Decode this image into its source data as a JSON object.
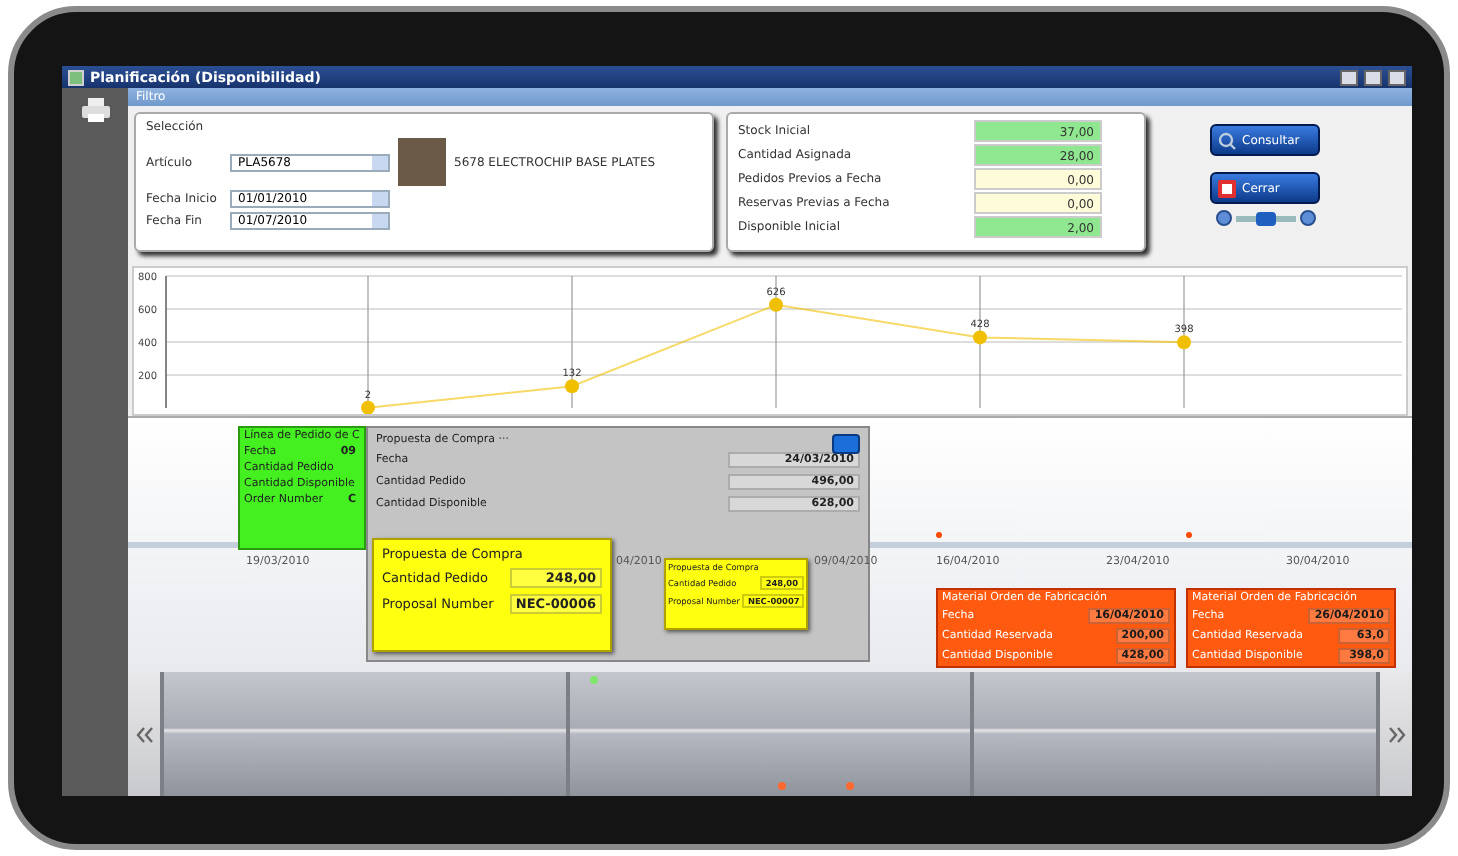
{
  "window": {
    "title": "Planificación (Disponibilidad)"
  },
  "filter_bar": {
    "title": "Filtro"
  },
  "selection": {
    "legend": "Selección",
    "article_label": "Artículo",
    "article": "PLA5678",
    "description": "5678 ELECTROCHIP BASE PLATES",
    "start_label": "Fecha Inicio",
    "start_date": "01/01/2010",
    "end_label": "Fecha Fin",
    "end_date": "01/07/2010"
  },
  "stock": [
    {
      "label": "Stock Inicial",
      "value": "37,00",
      "color": "#8fe88f"
    },
    {
      "label": "Cantidad Asignada",
      "value": "28,00",
      "color": "#8fe88f"
    },
    {
      "label": "Pedidos Previos a Fecha",
      "value": "0,00",
      "color": "#fdfbd8"
    },
    {
      "label": "Reservas Previas a Fecha",
      "value": "0,00",
      "color": "#fdfbd8"
    },
    {
      "label": "Disponible Inicial",
      "value": "2,00",
      "color": "#8fe88f"
    }
  ],
  "buttons": [
    {
      "label": "Consultar",
      "kind": "search"
    },
    {
      "label": "Cerrar",
      "kind": "close"
    }
  ],
  "zoom_slider": {
    "level": 0.5
  },
  "chart": {
    "chart_data": {
      "type": "line",
      "grid": true,
      "series": [
        {
          "color": "#f0c000",
          "marker": true,
          "values": [
            2,
            132,
            626,
            428,
            398
          ]
        }
      ],
      "ylim": [
        0,
        800
      ],
      "yticks": [
        200,
        400,
        600,
        800
      ],
      "data_labels": true
    }
  },
  "timeline": {
    "dates": [
      "19/03/2010",
      "04/2010",
      "09/04/2010",
      "16/04/2010",
      "23/04/2010",
      "30/04/2010"
    ],
    "cards": [
      {
        "kind": "order_line",
        "title": "Línea de Pedido de C",
        "fields": [
          {
            "label": "Fecha",
            "value": "09"
          },
          {
            "label": "Cantidad Pedido"
          },
          {
            "label": "Cantidad Disponible"
          },
          {
            "label": "Order Number",
            "value": "C"
          }
        ]
      },
      {
        "kind": "detail",
        "title": "Propuesta de Compra ···",
        "fields": [
          {
            "label": "Fecha",
            "value": "24/03/2010"
          },
          {
            "label": "Cantidad Pedido",
            "value": "496,00"
          },
          {
            "label": "Cantidad Disponible",
            "value": "628,00"
          }
        ]
      },
      {
        "kind": "proposal_large",
        "title": "Propuesta de Compra",
        "fields": [
          {
            "label": "Cantidad Pedido",
            "value": "248,00"
          },
          {
            "label": "Proposal Number",
            "value": "NEC-00006"
          }
        ]
      },
      {
        "kind": "proposal",
        "title": "Propuesta de Compra",
        "fields": [
          {
            "label": "Cantidad Pedido",
            "value": "248,00"
          },
          {
            "label": "Proposal Number",
            "value": "NEC-00007"
          }
        ]
      },
      {
        "kind": "manufacturing",
        "title": "Material Orden de Fabricación",
        "fields": [
          {
            "label": "Fecha",
            "value": "16/04/2010"
          },
          {
            "label": "Cantidad Reservada",
            "value": "200,00"
          },
          {
            "label": "Cantidad Disponible",
            "value": "428,00"
          }
        ]
      },
      {
        "kind": "manufacturing",
        "title": "Material Orden de Fabricación",
        "fields": [
          {
            "label": "Fecha",
            "value": "26/04/2010"
          },
          {
            "label": "Cantidad Reservada",
            "value": "63,0"
          },
          {
            "label": "Cantidad Disponible",
            "value": "398,0"
          }
        ]
      }
    ]
  }
}
